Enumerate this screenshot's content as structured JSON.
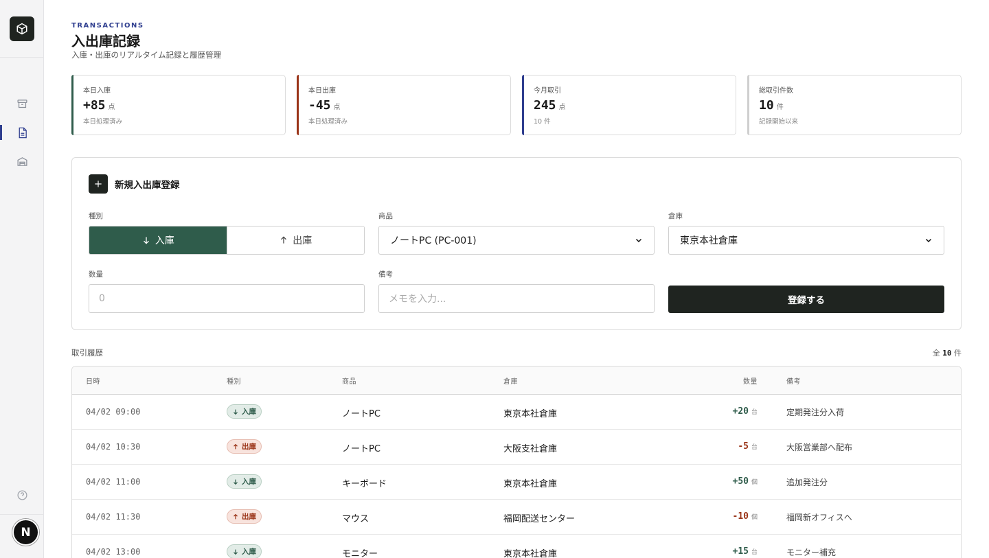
{
  "header": {
    "eyebrow": "TRANSACTIONS",
    "title": "入出庫記録",
    "subtitle": "入庫・出庫のリアルタイム記録と履歴管理"
  },
  "avatar": {
    "initial": "N"
  },
  "stats": [
    {
      "label": "本日入庫",
      "value": "+85",
      "unit": "点",
      "note": "本日処理済み",
      "accent": "#2f5c4b"
    },
    {
      "label": "本日出庫",
      "value": "-45",
      "unit": "点",
      "note": "本日処理済み",
      "accent": "#9a3418"
    },
    {
      "label": "今月取引",
      "value": "245",
      "unit": "点",
      "note": "10 件",
      "accent": "#2f3e8f"
    },
    {
      "label": "総取引件数",
      "value": "10",
      "unit": "件",
      "note": "記録開始以来",
      "accent": "#cfcfcf"
    }
  ],
  "form": {
    "title": "新規入出庫登録",
    "type_label": "種別",
    "type_in": "入庫",
    "type_out": "出庫",
    "product_label": "商品",
    "product_value": "ノートPC (PC-001)",
    "warehouse_label": "倉庫",
    "warehouse_value": "東京本社倉庫",
    "quantity_label": "数量",
    "quantity_placeholder": "0",
    "note_label": "備考",
    "note_placeholder": "メモを入力...",
    "submit_label": "登録する"
  },
  "history": {
    "label": "取引履歴",
    "count_prefix": "全",
    "count": "10",
    "count_suffix": "件",
    "columns": [
      "日時",
      "種別",
      "商品",
      "倉庫",
      "数量",
      "備考"
    ],
    "rows": [
      {
        "date": "04/02 09:00",
        "type": "入庫",
        "kind": "in",
        "product": "ノートPC",
        "warehouse": "東京本社倉庫",
        "qty": "+20",
        "unit": "台",
        "note": "定期発注分入荷"
      },
      {
        "date": "04/02 10:30",
        "type": "出庫",
        "kind": "out",
        "product": "ノートPC",
        "warehouse": "大阪支社倉庫",
        "qty": "-5",
        "unit": "台",
        "note": "大阪営業部へ配布"
      },
      {
        "date": "04/02 11:00",
        "type": "入庫",
        "kind": "in",
        "product": "キーボード",
        "warehouse": "東京本社倉庫",
        "qty": "+50",
        "unit": "個",
        "note": "追加発注分"
      },
      {
        "date": "04/02 11:30",
        "type": "出庫",
        "kind": "out",
        "product": "マウス",
        "warehouse": "福岡配送センター",
        "qty": "-10",
        "unit": "個",
        "note": "福岡新オフィスへ"
      },
      {
        "date": "04/02 13:00",
        "type": "入庫",
        "kind": "in",
        "product": "モニター",
        "warehouse": "東京本社倉庫",
        "qty": "+15",
        "unit": "台",
        "note": "モニター補充"
      }
    ]
  },
  "colors": {
    "in": "#2f5c4b",
    "out": "#9a3418",
    "brand": "#2f3e8f",
    "dark": "#1f2420"
  }
}
